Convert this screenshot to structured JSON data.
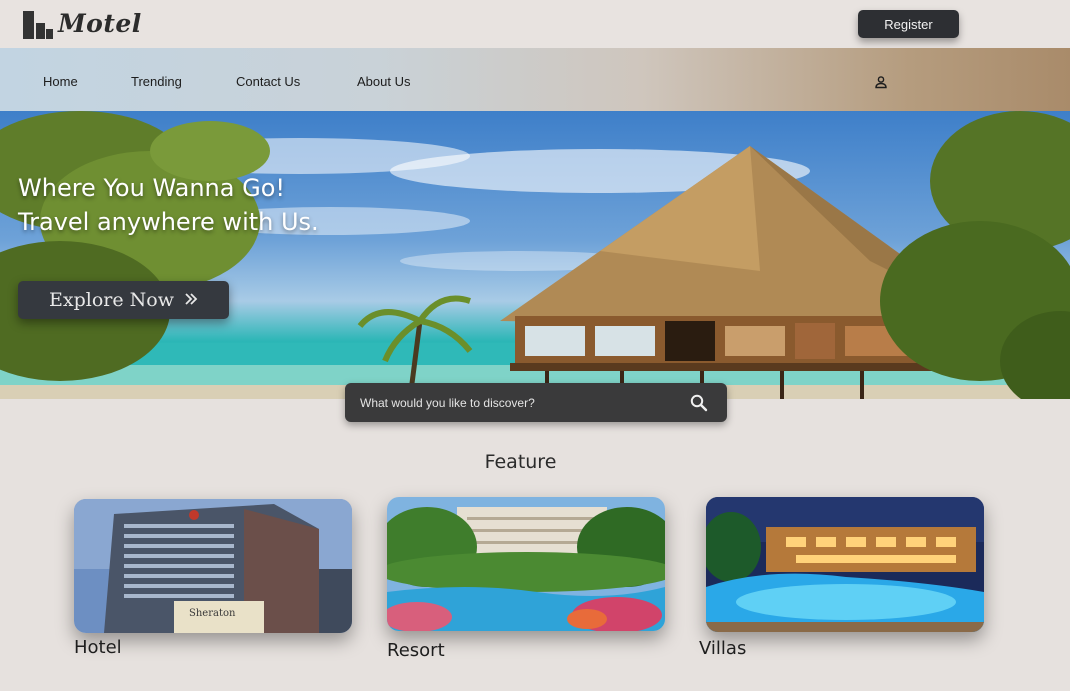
{
  "brand": {
    "name": "Motel"
  },
  "header": {
    "register_label": "Register"
  },
  "nav": {
    "items": [
      {
        "label": "Home"
      },
      {
        "label": "Trending"
      },
      {
        "label": "Contact Us"
      },
      {
        "label": "About Us"
      }
    ],
    "user_icon": "user-icon"
  },
  "hero": {
    "line1": "Where You Wanna Go!",
    "line2": "Travel anywhere with Us.",
    "cta_label": "Explore Now",
    "cta_icon": "double-chevron-right-icon"
  },
  "search": {
    "placeholder": "What would you like to discover?",
    "icon": "search-icon"
  },
  "feature": {
    "heading": "Feature",
    "cards": [
      {
        "label": "Hotel",
        "sign_text": "Sheraton"
      },
      {
        "label": "Resort"
      },
      {
        "label": "Villas"
      }
    ]
  },
  "colors": {
    "background": "#e6e1de",
    "button_dark": "#2d2f33",
    "nav_gradient_start": "#c2d4e2",
    "nav_gradient_end": "#a98b6a"
  }
}
